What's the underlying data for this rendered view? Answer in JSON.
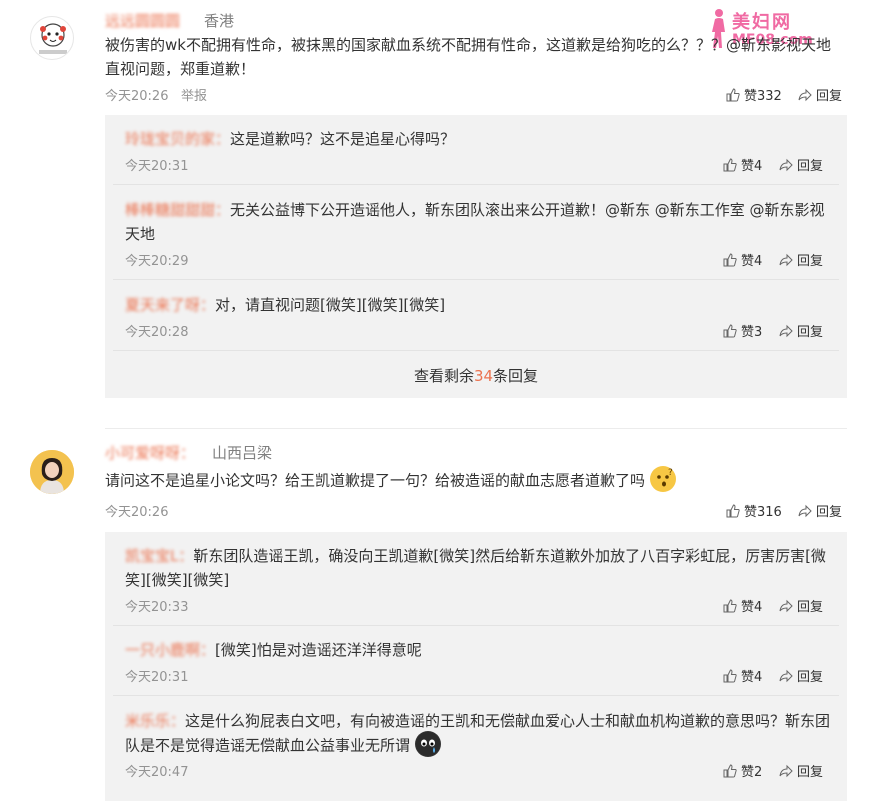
{
  "watermark": {
    "title": "美妇网",
    "sub": "MF08.com"
  },
  "comments": [
    {
      "username": "远远圆圆圆",
      "location": "香港",
      "text": "被伤害的wk不配拥有性命，被抹黑的国家献血系统不配拥有性命，这道歉是给狗吃的么？？？@靳东影视天地 直视问题，郑重道歉！",
      "time": "今天20:26",
      "report": "举报",
      "likes_label": "赞332",
      "reply_label": "回复",
      "replies": [
        {
          "name": "玲珑宝贝的家：",
          "text": "这是道歉吗？这不是追星心得吗？",
          "time": "今天20:31",
          "likes": "赞4",
          "reply": "回复"
        },
        {
          "name": "棒棒糖甜甜甜：",
          "text": "无关公益博下公开造谣他人，靳东团队滚出来公开道歉！@靳东 @靳东工作室 @靳东影视天地",
          "time": "今天20:29",
          "likes": "赞4",
          "reply": "回复"
        },
        {
          "name": "夏天来了呀：",
          "text": "对，请直视问题[微笑][微笑][微笑]",
          "time": "今天20:28",
          "likes": "赞3",
          "reply": "回复"
        }
      ],
      "more_prefix": "查看剩余",
      "more_count": "34",
      "more_suffix": "条回复"
    },
    {
      "username": "小可爱呀呀：",
      "location": "山西吕梁",
      "text": "请问这不是追星小论文吗？给王凯道歉提了一句？给被造谣的献血志愿者道歉了吗",
      "time": "今天20:26",
      "likes_label": "赞316",
      "reply_label": "回复",
      "replies": [
        {
          "name": "凯宝宝L：",
          "text": "靳东团队造谣王凯，确没向王凯道歉[微笑]然后给靳东道歉外加放了八百字彩虹屁，厉害厉害[微笑][微笑][微笑]",
          "time": "今天20:33",
          "likes": "赞4",
          "reply": "回复"
        },
        {
          "name": "一只小鹿啊：",
          "text": "[微笑]怕是对造谣还洋洋得意呢",
          "time": "今天20:31",
          "likes": "赞4",
          "reply": "回复"
        },
        {
          "name": "米乐乐：",
          "text": "这是什么狗屁表白文吧，有向被造谣的王凯和无偿献血爱心人士和献血机构道歉的意思吗？靳东团队是不是觉得造谣无偿献血公益事业无所谓",
          "time": "今天20:47",
          "likes": "赞2",
          "reply": "回复"
        }
      ]
    }
  ]
}
